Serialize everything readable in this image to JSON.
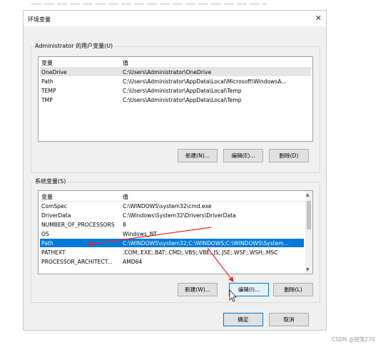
{
  "window": {
    "title": "环境变量",
    "close_glyph": "✕"
  },
  "user_vars": {
    "legend": "Administrator 的用户变量(U)",
    "headers": {
      "name": "变量",
      "value": "值"
    },
    "rows": [
      {
        "name": "OneDrive",
        "value": "C:\\Users\\Administrator\\OneDrive"
      },
      {
        "name": "Path",
        "value": "C:\\Users\\Administrator\\AppData\\Local\\Microsoft\\WindowsA..."
      },
      {
        "name": "TEMP",
        "value": "C:\\Users\\Administrator\\AppData\\Local\\Temp"
      },
      {
        "name": "TMP",
        "value": "C:\\Users\\Administrator\\AppData\\Local\\Temp"
      }
    ],
    "buttons": {
      "new": "新建(N)...",
      "edit": "编辑(E)...",
      "delete": "删除(D)"
    }
  },
  "system_vars": {
    "legend": "系统变量(S)",
    "headers": {
      "name": "变量",
      "value": "值"
    },
    "rows": [
      {
        "name": "ComSpec",
        "value": "C:\\WINDOWS\\system32\\cmd.exe"
      },
      {
        "name": "DriverData",
        "value": "C:\\Windows\\System32\\Drivers\\DriverData"
      },
      {
        "name": "NUMBER_OF_PROCESSORS",
        "value": "8"
      },
      {
        "name": "OS",
        "value": "Windows_NT"
      },
      {
        "name": "Path",
        "value": "C:\\WINDOWS\\system32;C:\\WINDOWS;C:\\WINDOWS\\System..."
      },
      {
        "name": "PATHEXT",
        "value": ".COM;.EXE;.BAT;.CMD;.VBS;.VBE;.JS;.JSE;.WSF;.WSH;.MSC"
      },
      {
        "name": "PROCESSOR_ARCHITECT...",
        "value": "AMD64"
      }
    ],
    "buttons": {
      "new": "新建(W)...",
      "edit": "编辑(I)...",
      "delete": "删除(L)"
    }
  },
  "footer": {
    "ok": "确定",
    "cancel": "取消"
  },
  "watermark": "CSDN @韧落270",
  "colors": {
    "selection": "#0078d7",
    "annotation_arrow": "#e8262b"
  }
}
